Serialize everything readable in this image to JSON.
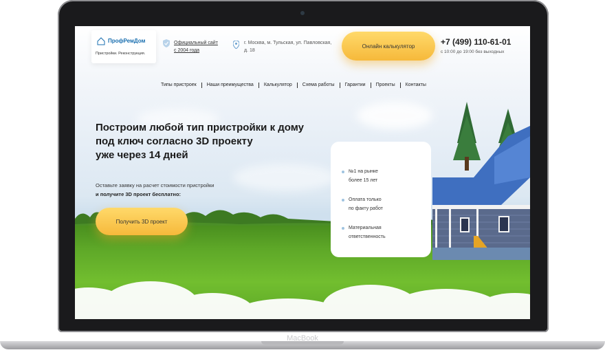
{
  "device": {
    "label": "MacBook"
  },
  "site": {
    "logo": {
      "name": "ПрофРемДом",
      "tagline": "Пристройки. Реконструкция."
    },
    "official": {
      "line1": "Официальный сайт",
      "line2": "с 2004 года"
    },
    "address": {
      "line1": "г. Москва, м. Тульская, ул. Павловская,",
      "line2": "д. 18"
    },
    "calc_button": "Онлайн калькулятор",
    "phone": "+7 (499) 110-61-01",
    "hours": "с 10:00 до 19:00 без выходных",
    "nav": [
      "Типы пристроек",
      "Наши преимущества",
      "Калькулятор",
      "Схема работы",
      "Гарантии",
      "Проекты",
      "Контакты"
    ],
    "hero": {
      "title_lines": [
        "Построим любой тип пристройки к дому",
        "под ключ согласно 3D проекту",
        "уже через 14 дней"
      ],
      "sub_line1": "Оставьте заявку на расчет стоимости пристройки",
      "sub_line2": "и получите 3D проект бесплатно:",
      "cta": "Получить 3D проект"
    },
    "advantages": [
      {
        "line1": "№1 на рынке",
        "line2": "более 15 лет"
      },
      {
        "line1": "Оплата только",
        "line2": "по факту работ"
      },
      {
        "line1": "Материальная",
        "line2": "ответственность"
      }
    ]
  },
  "colors": {
    "accent": "#f6b93b",
    "brand": "#1a6fb0",
    "roof": "#3f6fc0",
    "grass": "#66b02a"
  }
}
